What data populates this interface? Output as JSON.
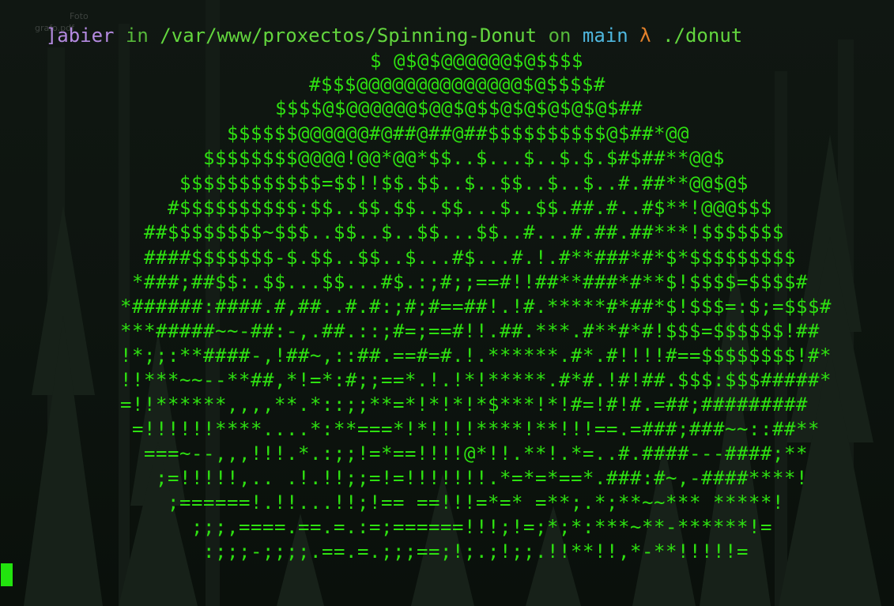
{
  "background": {
    "description": "dark pine forest wallpaper",
    "base_color": "#0c120d",
    "tree_color": "#18211a"
  },
  "desktop_ghost": {
    "name_line1": "Foto",
    "name_line2": "grafo.pdf"
  },
  "prompt": {
    "user": "]abier",
    "in_word": " in ",
    "path": "/var/www/proxectos/Spinning-Donut",
    "on_word": " on ",
    "branch": "main",
    "lambda": " λ ",
    "command": "./donut",
    "colors": {
      "user": "#b48ae0",
      "path": "#63d63e",
      "branch": "#4fb7df",
      "lambda": "#e4812b"
    }
  },
  "donut": {
    "color": "#2ee011",
    "lines": [
      "$ @$@$@@@@@@$@$$$$",
      "#$$$@@@@@@@@@@@@@@$@$$$$#",
      "$$$$@$@@@@@@$@@$@$$@$@$@$@$@$##",
      "$$$$$$@@@@@@#@##@##@##$$$$$$$$$$@$##*@@",
      "$$$$$$$$@@@@!@@*@@*$$..$...$..$.$.$#$##**@@$",
      "$$$$$$$$$$$$=$$!!$$.$$..$..$$..$..$..#.##**@@$@$",
      "#$$$$$$$$$$:$$..$$.$$..$$...$..$$.##.#..#$**!@@@$$$",
      "##$$$$$$$$~$$$..$$..$..$$...$$..#...#.##.##***!$$$$$$$",
      "####$$$$$$$-$.$$..$$..$...#$...#.!.#**###*#*$*$$$$$$$$$",
      "*###;##$$:.$$...$$...#$.:;#;;==#!!##**###*#**$!$$$$=$$$$#",
      "*######:####.#,##..#.#:;#;#==##!.!#.*****#*##*$!$$$=:$;=$$$#",
      "***#####~~-##:-,.##.::;#=;==#!!.##.***.#**#*#!$$$=$$$$$$!##",
      "!*;;:**####-,!##~,::##.==#=#.!.******.#*.#!!!!#==$$$$$$$$!#*",
      "!!***~~--**##,*!=*:#;;==*.!.!*!*****.#*#.!#!##.$$$:$$$#####*",
      "=!!******,,,,**.*::;;**=*!*!*!*$***!*!#=!#!#.=##;#########",
      "=!!!!!!****....*:**===*!*!!!!****!**!!!==.=###;###~~::##**",
      "===~--,,,!!!.*.:;;!=*==!!!!@*!!.**!.*=..#.####---####;**",
      ";=!!!!!,.. .!.!!;;=!=!!!!!!!.*=*=*==*.###:#~,-####****!",
      ";======!.!!...!!;!== ==!!!=*=* =**;.*;**~~*** *****!",
      ";;;,====.==.=.:=;======!!!;!=;*;*:***~**-******!=",
      ":;;;-;;;;.==.=.;;;==;!;.;!;;.!!**!!,*-**!!!!!="
    ]
  }
}
